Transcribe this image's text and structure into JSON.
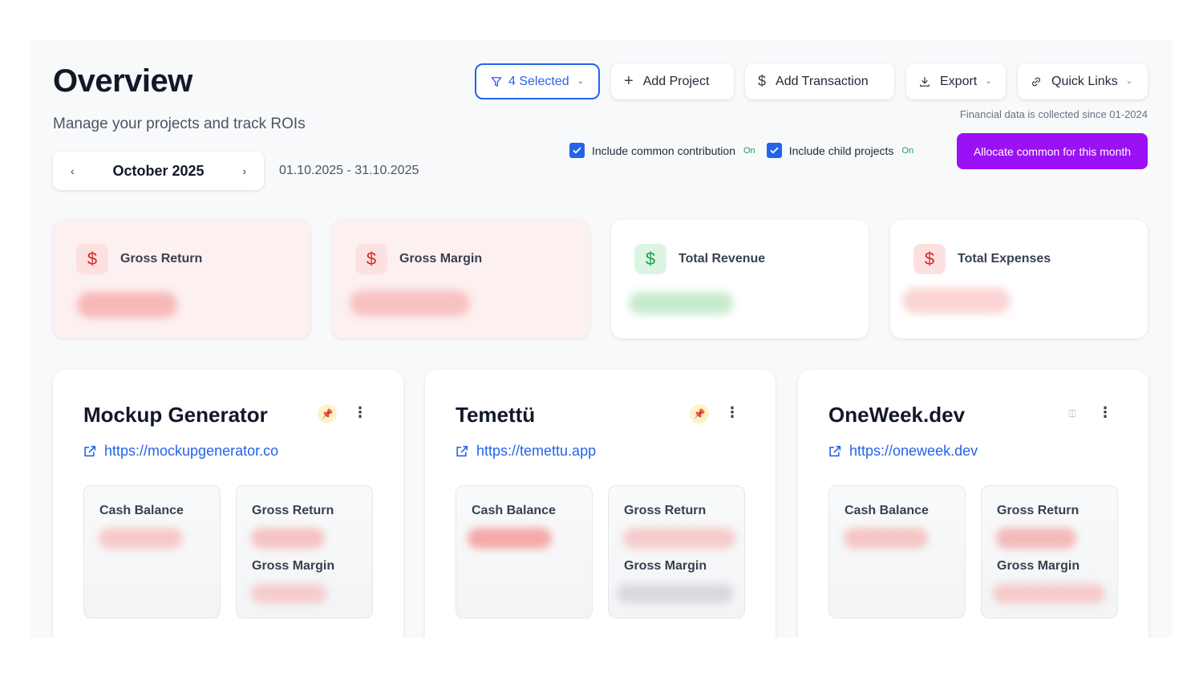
{
  "header": {
    "title": "Overview",
    "subtitle": "Manage your projects and track ROIs"
  },
  "period": {
    "month": "October 2025",
    "range": "01.10.2025 - 31.10.2025",
    "prev_icon": "chevron-left-icon",
    "next_icon": "chevron-right-icon"
  },
  "toolbar": {
    "filter_label": "4 Selected",
    "add_project_label": "Add Project",
    "add_transaction_label": "Add Transaction",
    "export_label": "Export",
    "quick_links_label": "Quick Links",
    "financial_note": "Financial data is collected since 01-2024"
  },
  "toggles": [
    {
      "label": "Include common contribution",
      "state": "On",
      "checked": true
    },
    {
      "label": "Include child projects",
      "state": "On",
      "checked": true
    }
  ],
  "allocate_label": "Allocate common for this month",
  "colors": {
    "accent": "#2563eb",
    "allocate": "#9b10f4",
    "negative": "#dc2626",
    "positive": "#16a34a"
  },
  "stats": [
    {
      "label": "Gross Return",
      "tone": "negative",
      "icon": "dollar-icon"
    },
    {
      "label": "Gross Margin",
      "tone": "negative",
      "icon": "dollar-icon"
    },
    {
      "label": "Total Revenue",
      "tone": "positive",
      "icon": "dollar-icon"
    },
    {
      "label": "Total Expenses",
      "tone": "negative",
      "icon": "dollar-icon"
    }
  ],
  "projects": [
    {
      "name": "Mockup Generator",
      "url": "https://mockupgenerator.co",
      "pinned": true,
      "metrics": {
        "cash_balance": "Cash Balance",
        "gross_return": "Gross Return",
        "gross_margin": "Gross Margin"
      }
    },
    {
      "name": "Temettü",
      "url": "https://temettu.app",
      "pinned": true,
      "metrics": {
        "cash_balance": "Cash Balance",
        "gross_return": "Gross Return",
        "gross_margin": "Gross Margin"
      }
    },
    {
      "name": "OneWeek.dev",
      "url": "https://oneweek.dev",
      "pinned": false,
      "metrics": {
        "cash_balance": "Cash Balance",
        "gross_return": "Gross Return",
        "gross_margin": "Gross Margin"
      }
    }
  ]
}
